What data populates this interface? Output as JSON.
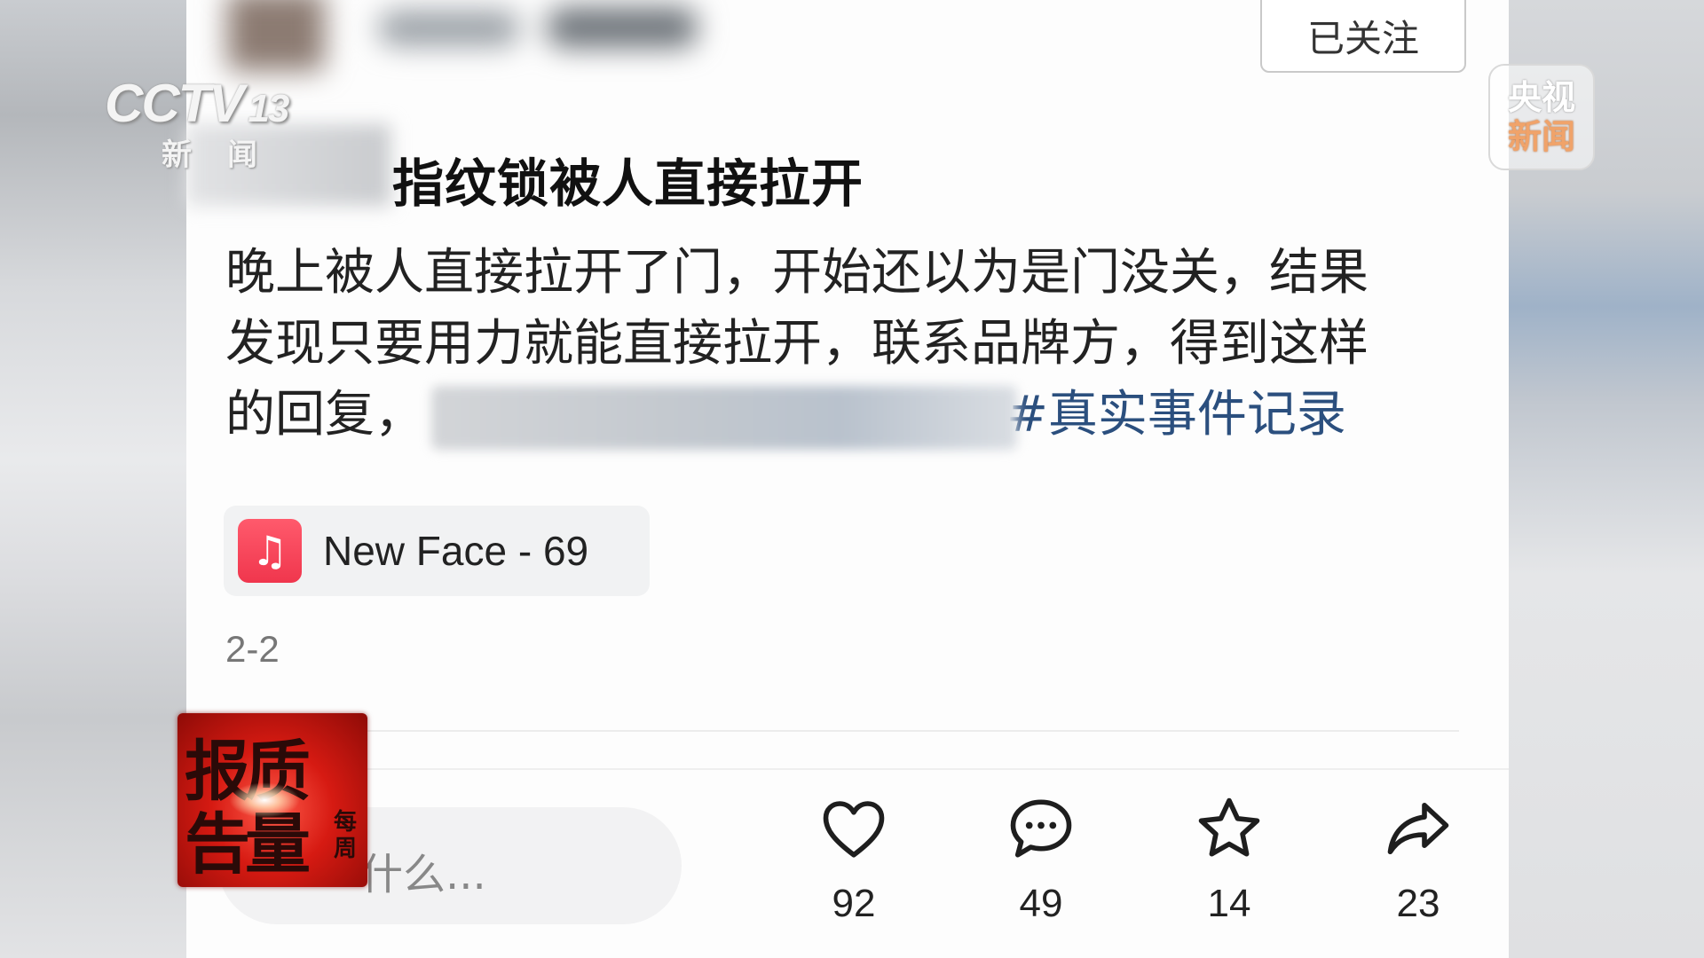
{
  "header": {
    "follow_label": "已关注"
  },
  "post": {
    "title": "指纹锁被人直接拉开",
    "body_lines": [
      "晚上被人直接拉开了门，开始还以为是门没关，结果",
      "发现只要用力就能直接拉开，联系品牌方，得到这样",
      "的回复，"
    ],
    "hashtag": "#真实事件记录",
    "music": {
      "label": "New Face - 69",
      "icon": "music-note-icon"
    },
    "date": "2-2"
  },
  "footer": {
    "comment_placeholder": "什么...",
    "actions": [
      {
        "name": "like",
        "icon": "heart-icon",
        "count": "92"
      },
      {
        "name": "comment",
        "icon": "comment-bubble-icon",
        "count": "49"
      },
      {
        "name": "favorite",
        "icon": "star-icon",
        "count": "14"
      },
      {
        "name": "share",
        "icon": "share-arrow-icon",
        "count": "23"
      }
    ]
  },
  "overlays": {
    "channel_logo": {
      "main": "CCTV",
      "number": "13",
      "sub": "新闻"
    },
    "news_badge": {
      "line1": "央视",
      "line2": "新闻"
    },
    "program_stamp": {
      "row1": "报质",
      "row2": "告量",
      "side": "每周"
    }
  },
  "colors": {
    "hashtag": "#2b4f7e",
    "music_icon": "#f0364d",
    "stamp": "#d61a12"
  }
}
